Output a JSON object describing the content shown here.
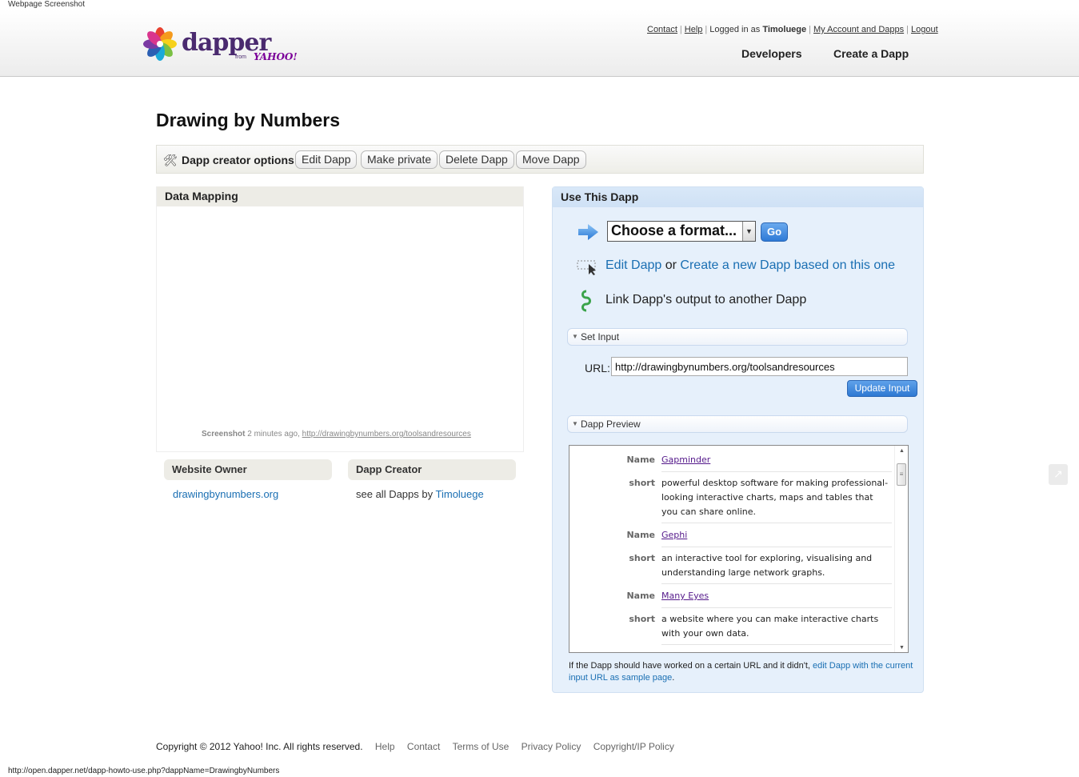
{
  "screenshot_label": "Webpage Screenshot",
  "logo": {
    "word": "dapper",
    "from": "from",
    "yahoo": "YAHOO!"
  },
  "toplinks": {
    "contact": "Contact",
    "help": "Help",
    "logged_in_prefix": "Logged in as",
    "user": "Timoluege",
    "account": "My Account and Dapps",
    "logout": "Logout"
  },
  "nav": {
    "developers": "Developers",
    "create": "Create a Dapp"
  },
  "title": "Drawing by Numbers",
  "options": {
    "label": "Dapp creator options",
    "buttons": [
      "Edit Dapp",
      "Make private",
      "Delete Dapp",
      "Move Dapp"
    ]
  },
  "data_mapping": {
    "header": "Data Mapping",
    "caption_bold": "Screenshot",
    "caption_time": "2 minutes ago,",
    "caption_url": "http://drawingbynumbers.org/toolsandresources"
  },
  "website_owner": {
    "header": "Website Owner",
    "value": "drawingbynumbers.org"
  },
  "dapp_creator": {
    "header": "Dapp Creator",
    "prefix": "see all Dapps by",
    "user": "Timoluege"
  },
  "use": {
    "header": "Use This Dapp",
    "format_select": "Choose a format...",
    "go": "Go",
    "edit_dapp": "Edit Dapp",
    "or": "or",
    "create_new": "Create a new Dapp based on this one",
    "link_output": "Link Dapp's output to another Dapp",
    "set_input": "Set Input",
    "url_label": "URL:",
    "url_value": "http://drawingbynumbers.org/toolsandresources",
    "update_input": "Update Input",
    "dapp_preview": "Dapp Preview",
    "preview_rows": [
      {
        "key": "Name",
        "value": "Gapminder",
        "link": true
      },
      {
        "key": "short",
        "value": "powerful desktop software for making professional-looking interactive charts, maps and tables that you can share online.",
        "link": false
      },
      {
        "key": "Name",
        "value": "Gephi",
        "link": true
      },
      {
        "key": "short",
        "value": "an interactive tool for exploring, visualising and understanding large network graphs.",
        "link": false
      },
      {
        "key": "Name",
        "value": "Many Eyes",
        "link": true
      },
      {
        "key": "short",
        "value": "a website where you can make interactive charts with your own data.",
        "link": false
      }
    ],
    "note_text": "If the Dapp should have worked on a certain URL and it didn't,",
    "note_link": "edit Dapp with the current input URL as sample page",
    "note_end": "."
  },
  "footer": {
    "copyright": "Copyright © 2012 Yahoo! Inc. All rights reserved.",
    "links": [
      "Help",
      "Contact",
      "Terms of Use",
      "Privacy Policy",
      "Copyright/IP Policy"
    ]
  },
  "status_url": "http://open.dapper.net/dapp-howto-use.php?dappName=DrawingbyNumbers"
}
